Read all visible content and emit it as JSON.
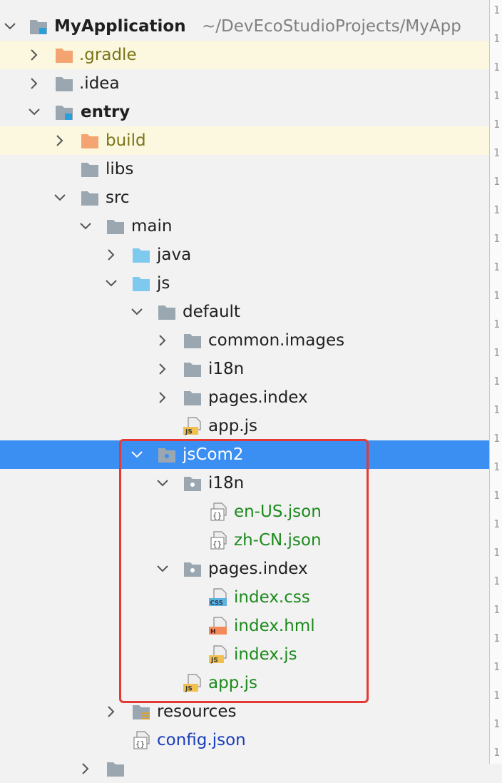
{
  "colors": {
    "selected_row": "#3c8ff2",
    "excluded_row": "#fbf8df",
    "excluded_text": "#7a7417",
    "new_file_text": "#1b8a1b",
    "config_text": "#1a3dba",
    "annotation_box": "#e53935"
  },
  "project": {
    "name": "MyApplication",
    "path": "~/DevEcoStudioProjects/MyApp"
  },
  "tree": {
    "gradle": ".gradle",
    "idea": ".idea",
    "entry": "entry",
    "build": "build",
    "libs": "libs",
    "src": "src",
    "main": "main",
    "java": "java",
    "js": "js",
    "default": "default",
    "common_images": "common.images",
    "i18n": "i18n",
    "pages_index": "pages.index",
    "app_js": "app.js",
    "jscom2": "jsCom2",
    "jscom2_i18n": "i18n",
    "en_us": "en-US.json",
    "zh_cn": "zh-CN.json",
    "jscom2_pages_index": "pages.index",
    "index_css": "index.css",
    "index_hml": "index.hml",
    "index_js": "index.js",
    "jscom2_app_js": "app.js",
    "resources": "resources",
    "config_json": "config.json"
  },
  "gutter": {
    "line_marker": "1"
  }
}
